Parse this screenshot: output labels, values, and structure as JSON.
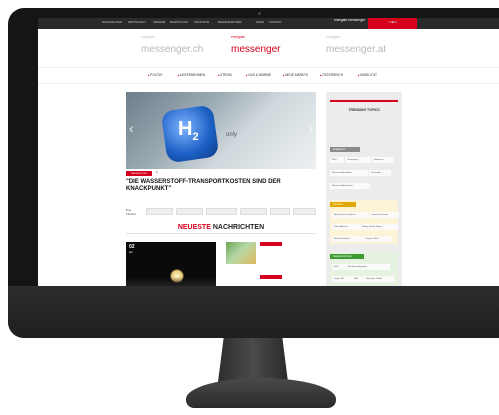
{
  "site": {
    "topnav": [
      "NACHRICHTEN",
      "WIRTSCHAFT",
      "TERMINE",
      "MARKTPLATZ",
      "PRODUKTE",
      "MEDIENPARTNER",
      "NEWS",
      "KONTAKT"
    ],
    "topnav_logo": "energate messenger",
    "login_label": "LOGIN",
    "brands": {
      "left": {
        "pre": "energate",
        "name": "messenger.ch"
      },
      "center": {
        "pre": "energate",
        "name": "messenger"
      },
      "right": {
        "pre": "energate",
        "name": "messenger.at"
      }
    },
    "categories": [
      "POLITIK",
      "UNTERNEHMEN",
      "STROM",
      "GAS & WÄRME",
      "NEUE MÄRKTE",
      "ÖSTERREICH",
      "MOBILITÄT"
    ],
    "hero": {
      "category": "WASSERSTOFF",
      "headline": "\"DIE WASSERSTOFF-TRANSPORTKOSTEN SIND DER KNACKPUNKT\"",
      "image_text_h": "H",
      "image_text_sub": "2",
      "image_text_fuel": "only"
    },
    "top_themen": {
      "label": "Top-Themen",
      "chips": [
        "",
        "",
        "",
        "",
        "",
        ""
      ]
    },
    "neueste": {
      "word1": "NEUESTE",
      "word2": "NACHRICHTEN"
    },
    "card_dark": {
      "day": "02",
      "month": "Apr."
    },
    "card_title": "",
    "trending": {
      "title": "TRENDING TOPICS",
      "groups": [
        {
          "label": "Erdgasnetz",
          "color": "#8a8a8a",
          "chips": [
            "EEG",
            "Gasmangel",
            "Biomasse",
            "Wasserstoffmobilität",
            "Preisradar",
            "Wasserstoffwirtschaft"
          ]
        },
        {
          "label": "Personen",
          "color": "#e0a800",
          "chips": [
            "Andreas Scheuerbeck",
            "Lorenzo Ganasini",
            "Peter Altmaier",
            "Philipp Pieller-Haase",
            "Bernd Westphal",
            "Thomas Pflüll"
          ]
        },
        {
          "label": "Regulierbehörden",
          "color": "#3c9a2f",
          "chips": [
            "EZG",
            "Bundesnetzagentur",
            "Uniper SE",
            "EIA",
            "Heizungs GmbH"
          ]
        }
      ]
    }
  }
}
